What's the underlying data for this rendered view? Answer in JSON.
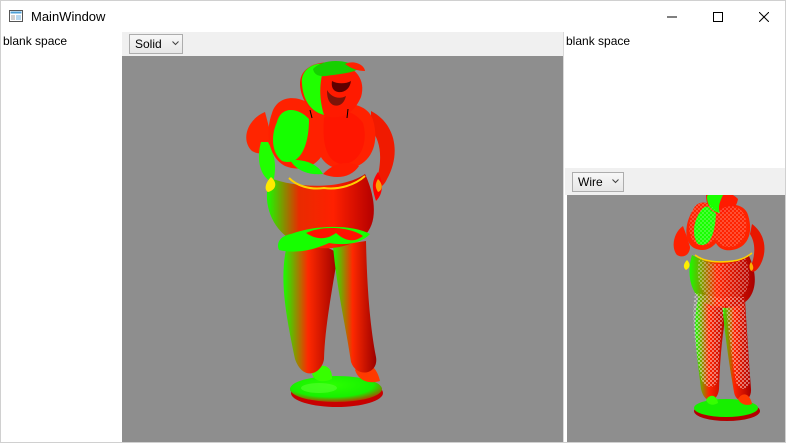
{
  "window": {
    "title": "MainWindow"
  },
  "left_pane": {
    "text": "blank space"
  },
  "right_pane": {
    "text": "blank space"
  },
  "main_view": {
    "render_mode": "Solid"
  },
  "secondary_view": {
    "render_mode": "Wire"
  },
  "icons": {
    "app": "window-icon",
    "minimize": "minimize-icon",
    "maximize": "maximize-icon",
    "close": "close-icon",
    "dropdown": "chevron-down-icon"
  },
  "colors": {
    "viewport_background": "#8e8e8e",
    "panel_background": "#f0f0f0",
    "model_red": "#ff1200",
    "model_green": "#16ff00",
    "wire_white": "#ffffff"
  }
}
